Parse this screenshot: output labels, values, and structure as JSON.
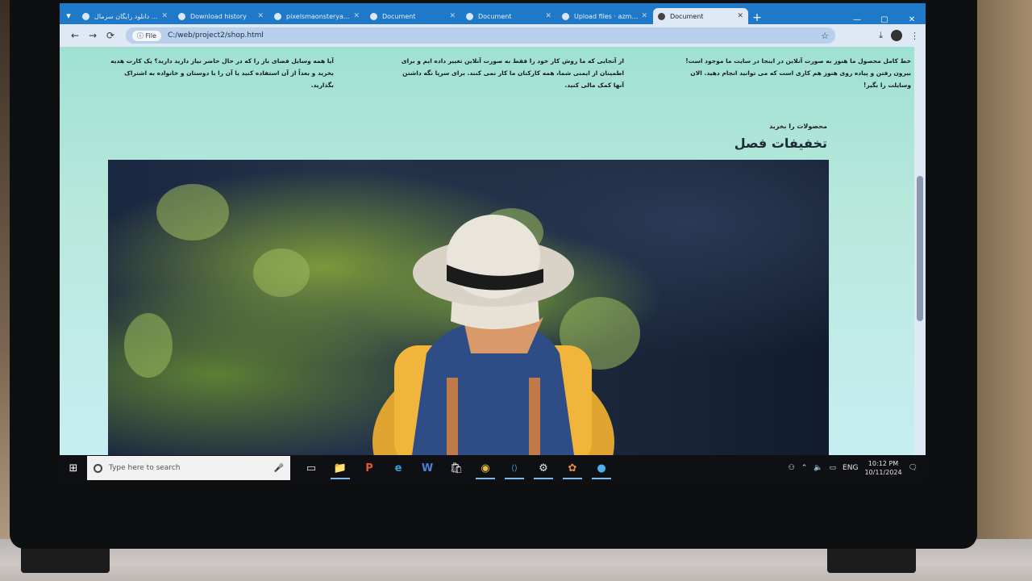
{
  "browser": {
    "tabs": [
      {
        "title": "دانلود رایگان سرمال | ..."
      },
      {
        "title": "Download history"
      },
      {
        "title": "pixelsmaonsteryaya..."
      },
      {
        "title": "Document"
      },
      {
        "title": "Document"
      },
      {
        "title": "Upload files · azmon..."
      },
      {
        "title": "Document",
        "active": true
      }
    ],
    "new_tab": "+",
    "window_controls": [
      "—",
      "▢",
      "✕"
    ],
    "nav": {
      "back": "←",
      "forward": "→",
      "reload": "⟳"
    },
    "address": {
      "chip": "ⓘ File",
      "url": "C:/web/project2/shop.html"
    },
    "bookmark_star": "☆"
  },
  "page": {
    "columns": [
      {
        "text": "خط کامل محصول ما هنوز به صورت آنلاین در اینجا در سایت ما موجود است! بیرون رفتن و پیاده روی هنوز هم کاری است که می توانید انجام دهید. الان وسایلت را بگیر!"
      },
      {
        "text": "از آنجایی که ما روش کار خود را فقط به صورت آنلاین تغییر داده ایم و برای اطمینان از ایمنی شما، همه کارکنان ما کار نمی کنند. برای سرپا نگه داشتن آنها کمک مالی کنید."
      },
      {
        "text": "آیا همه وسایل فضای باز را که در حال حاضر نیاز دارید دارید؟ یک کارت هدیه بخرید و بعداً از آن استفاده کنید یا آن را با دوستان و خانواده به اشتراک بگذارید."
      }
    ],
    "section_kicker": "محصولات را بخرید",
    "section_title": "تخفیفات فصل"
  },
  "taskbar": {
    "start": "⊞",
    "search_placeholder": "Type here to search",
    "mic": "🎤",
    "apps": [
      {
        "name": "task-view-icon",
        "glyph": "▭"
      },
      {
        "name": "file-explorer-icon",
        "glyph": "📁"
      },
      {
        "name": "powerpoint-icon",
        "glyph": "P"
      },
      {
        "name": "edge-icon",
        "glyph": "e"
      },
      {
        "name": "word-icon",
        "glyph": "W"
      },
      {
        "name": "store-icon",
        "glyph": "🛍"
      },
      {
        "name": "chrome-icon",
        "glyph": "◉"
      },
      {
        "name": "vscode-icon",
        "glyph": "⟨⟩"
      },
      {
        "name": "settings-icon",
        "glyph": "⚙"
      },
      {
        "name": "photos-icon",
        "glyph": "✿"
      },
      {
        "name": "browser-icon",
        "glyph": "●"
      }
    ],
    "tray": {
      "lang": "ENG",
      "time": "10:12 PM",
      "date": "10/11/2024"
    }
  },
  "colors": {
    "tab_strip": "#1f78c8",
    "page_bg": "#9fe1d3",
    "taskbar": "#0f1014"
  }
}
